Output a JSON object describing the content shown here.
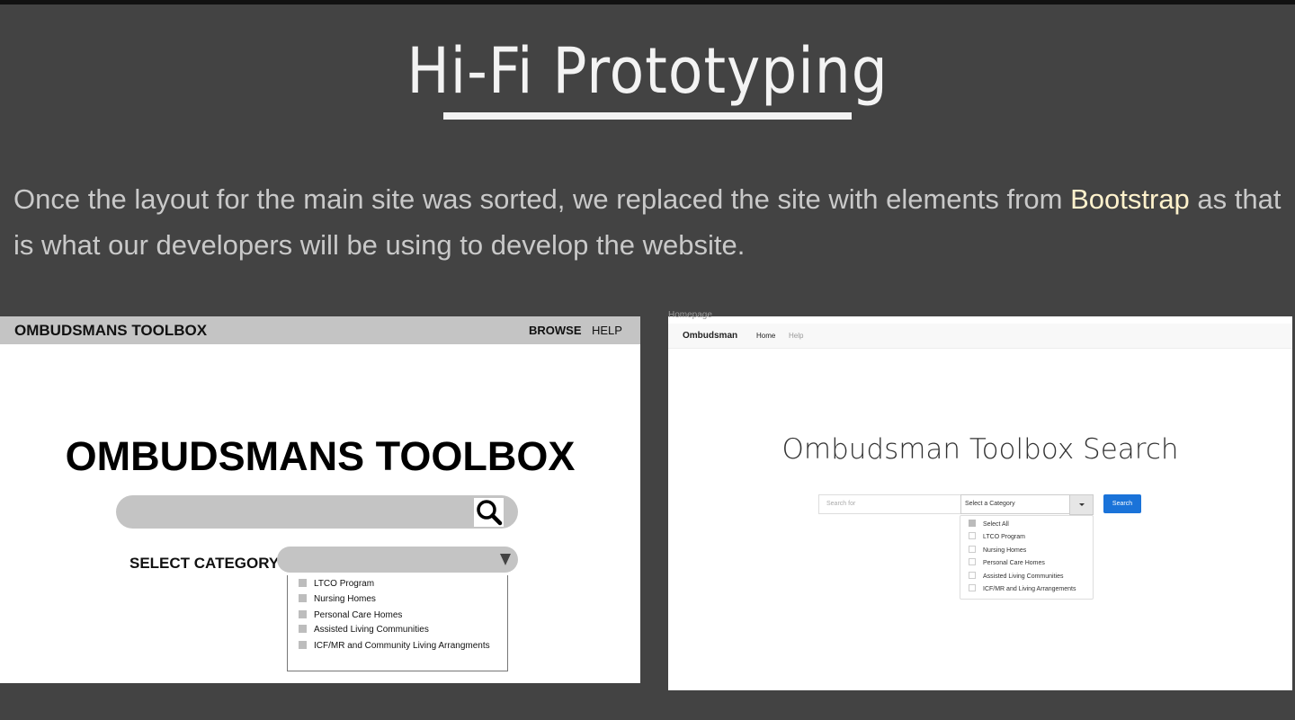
{
  "slide": {
    "title": "Hi-Fi Prototyping",
    "intro_before": "Once the layout for the main site was sorted, we replaced the site with elements from ",
    "intro_highlight": "Bootstrap",
    "intro_after": " as that is what our developers will be using to develop the website."
  },
  "wireframe": {
    "brand": "OMBUDSMANS TOOLBOX",
    "nav": [
      "BROWSE",
      "HELP"
    ],
    "heading": "OMBUDSMANS TOOLBOX",
    "search_icon": "search-icon",
    "category_label": "SELECT CATEGORY",
    "dropdown_icon": "triangle-down-icon",
    "categories": [
      "LTCO Program",
      "Nursing Homes",
      "Personal Care Homes",
      "Assisted Living Communities",
      "ICF/MR and Community Living Arrangments"
    ]
  },
  "bootstrap_mock": {
    "caption": "Homepage",
    "brand": "Ombudsman",
    "nav": [
      "Home",
      "Help"
    ],
    "heading": "Ombudsman Toolbox Search",
    "search_placeholder": "Search for",
    "select_value": "Select a Category",
    "search_button": "Search",
    "options": [
      "Select All",
      "LTCO Program",
      "Nursing Homes",
      "Personal Care Homes",
      "Assisted Living Communities",
      "ICF/MR and Living Arrangements"
    ],
    "accent_color": "#1a73d9"
  }
}
